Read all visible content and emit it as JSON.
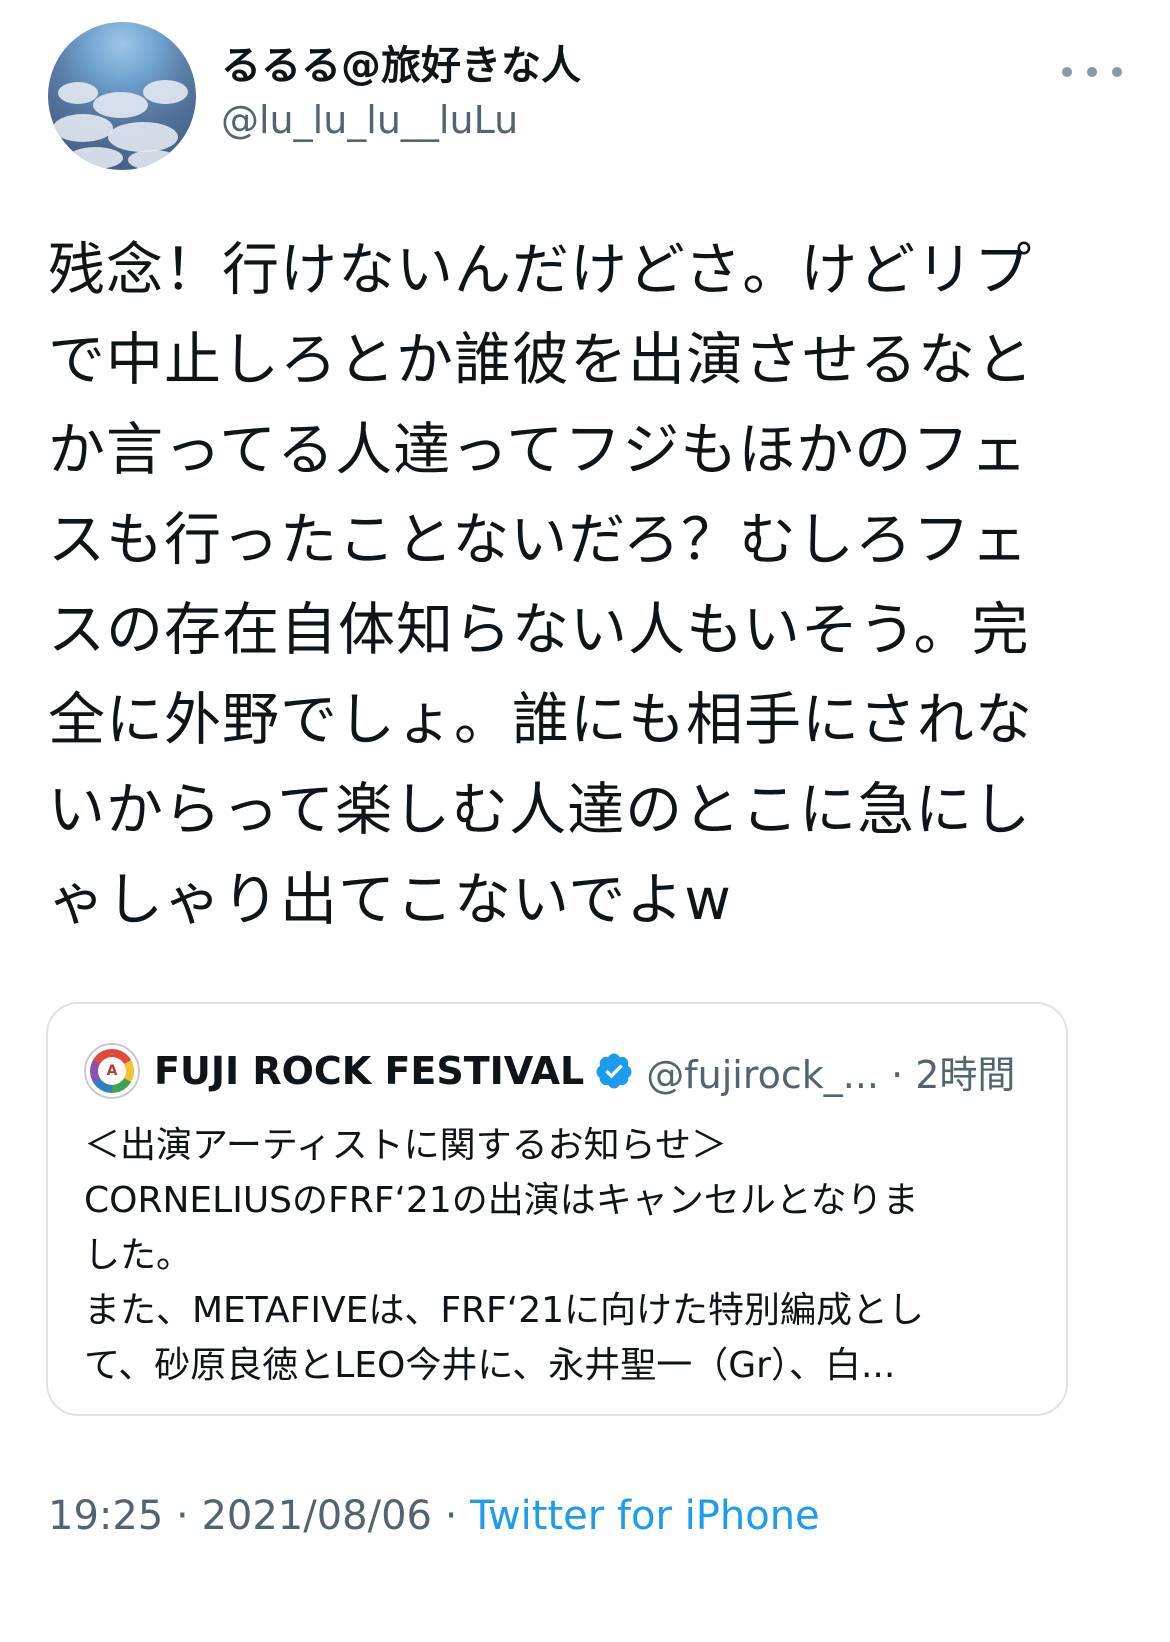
{
  "author": {
    "display_name": "るるる@旅好きな人",
    "handle": "@lu_lu_lu__luLu"
  },
  "more_icon": "more-horizontal-icon",
  "tweet_text": "残念！行けないんだけどさ。けどリプ\nで中止しろとか誰彼を出演させるなと\nか言ってる人達ってフジもほかのフェ\nスも行ったことないだろ？むしろフェ\nスの存在自体知らない人もいそう。完\n全に外野でしょ。誰にも相手にされな\nいからって楽しむ人達のとこに急にし\nゃしゃり出てこないでよw",
  "quote": {
    "name": "FUJI ROCK FESTIVAL",
    "verified_icon": "verified-badge-icon",
    "handle_time": "@fujirock_... · 2時間",
    "text": "＜出演アーティストに関するお知らせ＞\nCORNELIUSのFRF‘21の出演はキャンセルとなりま\nした。\nまた、METAFIVEは、FRF‘21に向けた特別編成とし\nて、砂原良徳とLEO今井に、永井聖一（Gr）、白..."
  },
  "meta": {
    "time": "19:25",
    "separator": " · ",
    "date": "2021/08/06",
    "source": "Twitter for iPhone"
  },
  "colors": {
    "text": "#0f1419",
    "secondary": "#536471",
    "link": "#1d9bf0",
    "border": "#dfe3e7"
  }
}
